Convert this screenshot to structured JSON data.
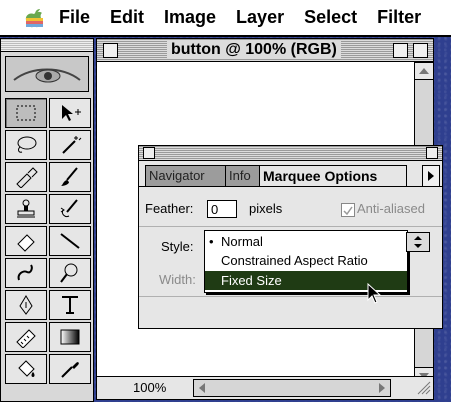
{
  "menubar": {
    "items": [
      "File",
      "Edit",
      "Image",
      "Layer",
      "Select",
      "Filter"
    ]
  },
  "document": {
    "title": "button @ 100% (RGB)",
    "zoom": "100%"
  },
  "palette": {
    "tabs": [
      "Navigator",
      "Info",
      "Marquee Options"
    ],
    "feather_label": "Feather:",
    "feather_value": "0",
    "feather_unit": "pixels",
    "antialiased_label": "Anti-aliased",
    "style_label": "Style:",
    "width_label": "Width:"
  },
  "style_menu": {
    "options": [
      "Normal",
      "Constrained Aspect Ratio",
      "Fixed Size"
    ],
    "checked": "Normal",
    "highlighted": "Fixed Size"
  },
  "colors": {
    "desktop": "#2f3f8f",
    "highlight": "#1f3b14"
  },
  "icons": {
    "toolbox": [
      "eye-logo-icon",
      "marquee-icon",
      "move-icon",
      "lasso-icon",
      "magic-wand-icon",
      "airbrush-icon",
      "paintbrush-icon",
      "rubber-stamp-icon",
      "history-brush-icon",
      "eraser-icon",
      "line-icon",
      "blur-icon",
      "dodge-icon",
      "pen-icon",
      "type-icon",
      "measure-icon",
      "gradient-icon",
      "paint-bucket-icon",
      "eyedropper-icon"
    ]
  }
}
